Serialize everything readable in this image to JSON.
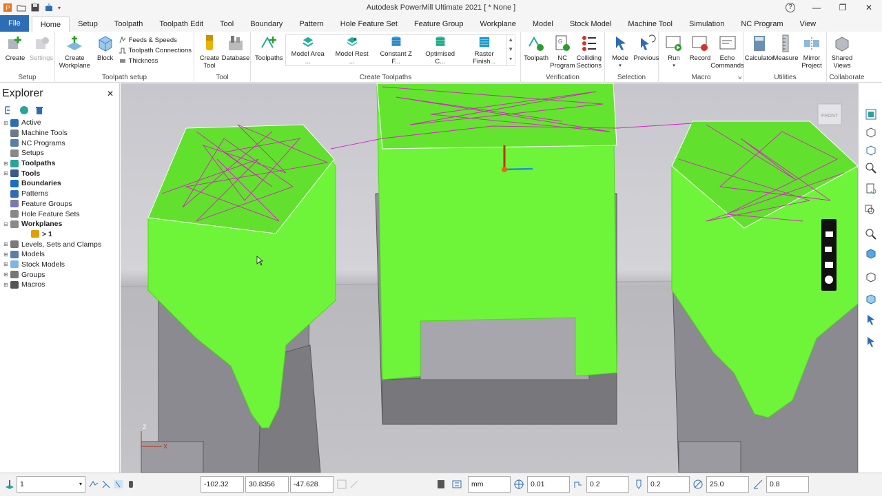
{
  "title_bar": {
    "app_title": "Autodesk PowerMill Ultimate 2021   [ * None ]",
    "help": "?",
    "minimize": "—",
    "restore": "❐",
    "close": "✕"
  },
  "tabs": [
    "File",
    "Home",
    "Setup",
    "Toolpath",
    "Toolpath Edit",
    "Tool",
    "Boundary",
    "Pattern",
    "Hole Feature Set",
    "Feature Group",
    "Workplane",
    "Model",
    "Stock Model",
    "Machine Tool",
    "Simulation",
    "NC Program",
    "View"
  ],
  "active_tab": "Home",
  "ribbon": {
    "setup": {
      "label": "Setup",
      "create": "Create",
      "settings": "Settings"
    },
    "toolpath_setup": {
      "label": "Toolpath setup",
      "create_workplane_1": "Create",
      "create_workplane_2": "Workplane",
      "block": "Block",
      "feeds": "Feeds & Speeds",
      "connections": "Toolpath Connections",
      "thickness": "Thickness"
    },
    "tool": {
      "label": "Tool",
      "create_tool_1": "Create",
      "create_tool_2": "Tool",
      "database": "Database"
    },
    "create_toolpaths": {
      "label": "Create Toolpaths",
      "toolpaths": "Toolpaths",
      "gallery": [
        "Model Area ...",
        "Model Rest ...",
        "Constant Z F...",
        "Optimised C...",
        "Raster Finish..."
      ]
    },
    "verification": {
      "label": "Verification",
      "toolpath": "Toolpath",
      "nc_1": "NC",
      "nc_2": "Program",
      "coll_1": "Colliding",
      "coll_2": "Sections"
    },
    "selection": {
      "label": "Selection",
      "mode": "Mode",
      "previous": "Previous"
    },
    "macro": {
      "label": "Macro",
      "run": "Run",
      "record": "Record",
      "echo_1": "Echo",
      "echo_2": "Commands"
    },
    "utilities": {
      "label": "Utilities",
      "calculator": "Calculator",
      "measure": "Measure",
      "mirror_1": "Mirror",
      "mirror_2": "Project"
    },
    "collaborate": {
      "label": "Collaborate",
      "shared_1": "Shared",
      "shared_2": "Views"
    }
  },
  "explorer": {
    "title": "Explorer",
    "close": "✕",
    "items": [
      {
        "label": "Active",
        "bold": false,
        "icon": "active-icon"
      },
      {
        "label": "Machine Tools",
        "bold": false,
        "icon": "machine-tool-icon"
      },
      {
        "label": "NC Programs",
        "bold": false,
        "icon": "nc-program-icon"
      },
      {
        "label": "Setups",
        "bold": false,
        "icon": "setup-icon"
      },
      {
        "label": "Toolpaths",
        "bold": true,
        "icon": "toolpath-icon"
      },
      {
        "label": "Tools",
        "bold": true,
        "icon": "tool-icon"
      },
      {
        "label": "Boundaries",
        "bold": true,
        "icon": "boundary-icon"
      },
      {
        "label": "Patterns",
        "bold": false,
        "icon": "pattern-icon"
      },
      {
        "label": "Feature Groups",
        "bold": false,
        "icon": "feature-group-icon"
      },
      {
        "label": "Hole Feature Sets",
        "bold": false,
        "icon": "hole-feature-icon"
      },
      {
        "label": "Workplanes",
        "bold": true,
        "icon": "workplane-icon"
      },
      {
        "label": "> 1",
        "bold": true,
        "icon": "workplane-item-icon"
      },
      {
        "label": "Levels, Sets and Clamps",
        "bold": false,
        "icon": "levels-icon"
      },
      {
        "label": "Models",
        "bold": false,
        "icon": "model-icon"
      },
      {
        "label": "Stock Models",
        "bold": false,
        "icon": "stock-model-icon"
      },
      {
        "label": "Groups",
        "bold": false,
        "icon": "group-icon"
      },
      {
        "label": "Macros",
        "bold": false,
        "icon": "macro-icon"
      }
    ]
  },
  "viewport": {
    "viewcube_label": "FRONT",
    "axis_z": "Z",
    "axis_x": "X"
  },
  "status": {
    "workplane": "1",
    "x": "-102.32",
    "y": "30.8356",
    "z": "-47.628",
    "units": "mm",
    "tolerance": "0.01",
    "thickness": "0.2",
    "axial_thickness": "0.2",
    "diameter": "25.0",
    "stepover": "0.8"
  }
}
